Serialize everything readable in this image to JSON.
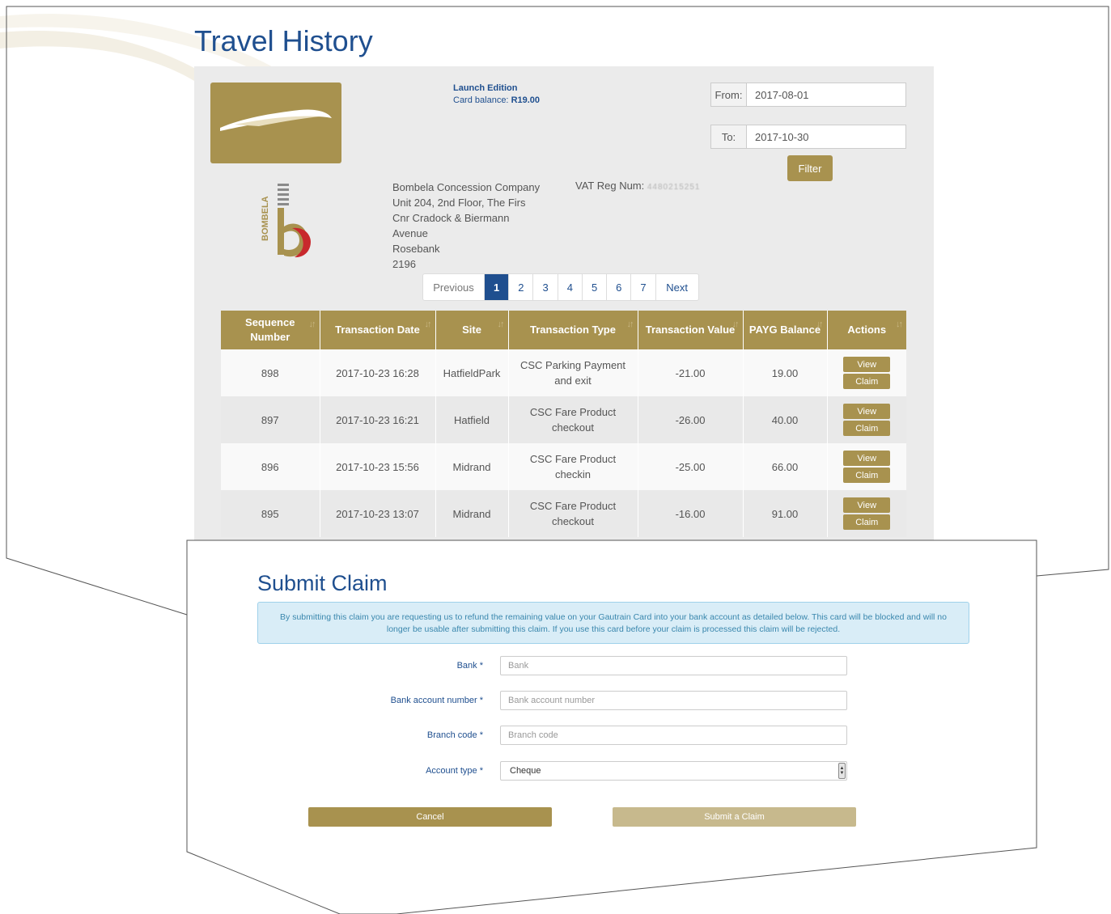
{
  "colors": {
    "accent_gold": "#a8924f",
    "accent_gold_light": "#c7b98d",
    "title_blue": "#1f4f8f",
    "alert_bg": "#d9edf7",
    "alert_text": "#3a87ad",
    "brand_red": "#c8282d"
  },
  "travel_history": {
    "title": "Travel History",
    "card": {
      "edition": "Launch Edition",
      "balance_label": "Card balance:",
      "balance_value": "R19.00"
    },
    "bombela_logo_text": "BOMBELA",
    "filter": {
      "from_label": "From:",
      "from_value": "2017-08-01",
      "to_label": "To:",
      "to_value": "2017-10-30",
      "button_label": "Filter"
    },
    "company_address": [
      "Bombela Concession Company",
      "Unit 204, 2nd Floor, The Firs",
      "Cnr Cradock & Biermann",
      "Avenue",
      "Rosebank",
      "2196"
    ],
    "vat": {
      "label": "VAT Reg Num:",
      "value": "4480215251"
    },
    "pagination": {
      "previous": "Previous",
      "pages": [
        "1",
        "2",
        "3",
        "4",
        "5",
        "6",
        "7"
      ],
      "active_page": "1",
      "next": "Next"
    },
    "table": {
      "columns": [
        "Sequence Number",
        "Transaction Date",
        "Site",
        "Transaction Type",
        "Transaction Value",
        "PAYG Balance",
        "Actions"
      ],
      "rows": [
        {
          "seq": "898",
          "date": "2017-10-23 16:28",
          "site": "HatfieldPark",
          "type": "CSC Parking Payment and exit",
          "value": "-21.00",
          "balance": "19.00"
        },
        {
          "seq": "897",
          "date": "2017-10-23 16:21",
          "site": "Hatfield",
          "type": "CSC Fare Product checkout",
          "value": "-26.00",
          "balance": "40.00"
        },
        {
          "seq": "896",
          "date": "2017-10-23 15:56",
          "site": "Midrand",
          "type": "CSC Fare Product checkin",
          "value": "-25.00",
          "balance": "66.00"
        },
        {
          "seq": "895",
          "date": "2017-10-23 13:07",
          "site": "Midrand",
          "type": "CSC Fare Product checkout",
          "value": "-16.00",
          "balance": "91.00"
        }
      ],
      "view_label": "View",
      "claim_label": "Claim"
    }
  },
  "submit_claim": {
    "title": "Submit Claim",
    "notice": "By submitting this claim you are requesting us to refund the remaining value on your Gautrain Card into your bank account as detailed below. This card will be blocked and will no longer be usable after submitting this claim. If you use this card before your claim is processed this claim will be rejected.",
    "required_marker": "*",
    "fields": {
      "bank": {
        "label": "Bank",
        "placeholder": "Bank"
      },
      "account_number": {
        "label": "Bank account number",
        "placeholder": "Bank account number"
      },
      "branch_code": {
        "label": "Branch code",
        "placeholder": "Branch code"
      },
      "account_type": {
        "label": "Account type",
        "selected": "Cheque"
      }
    },
    "cancel_label": "Cancel",
    "submit_label": "Submit a Claim"
  }
}
